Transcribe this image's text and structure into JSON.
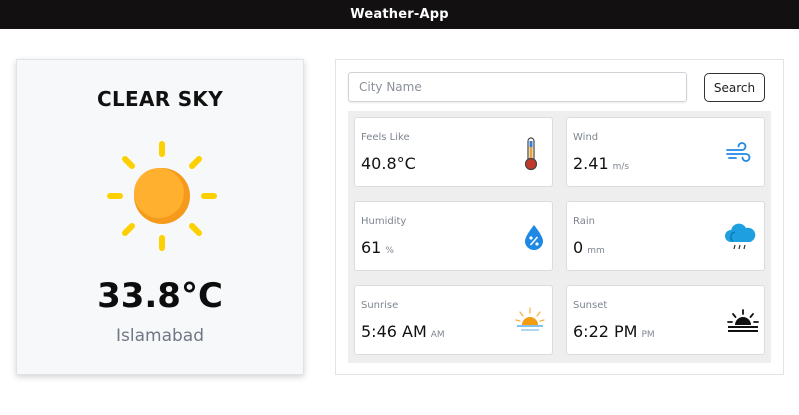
{
  "app": {
    "title": "Weather-App"
  },
  "current": {
    "condition": "CLEAR SKY",
    "temperature": "33.8°C",
    "city": "Islamabad",
    "icon": "sun-icon"
  },
  "search": {
    "placeholder": "City Name",
    "value": "",
    "button_label": "Search"
  },
  "stats": [
    {
      "label": "Feels Like",
      "value": "40.8°C",
      "unit": "",
      "icon": "thermometer-icon"
    },
    {
      "label": "Wind",
      "value": "2.41",
      "unit": "m/s",
      "icon": "wind-icon"
    },
    {
      "label": "Humidity",
      "value": "61",
      "unit": "%",
      "icon": "humidity-drop-icon"
    },
    {
      "label": "Rain",
      "value": "0",
      "unit": "mm",
      "icon": "rain-cloud-icon"
    },
    {
      "label": "Sunrise",
      "value": "5:46 AM",
      "unit": "AM",
      "icon": "sunrise-icon"
    },
    {
      "label": "Sunset",
      "value": "6:22 PM",
      "unit": "PM",
      "icon": "sunset-icon"
    }
  ],
  "colors": {
    "topbar": "#121010",
    "sun": "#ffb02e",
    "sun_rays": "#ffd000",
    "icon_blue": "#1e88e5"
  }
}
